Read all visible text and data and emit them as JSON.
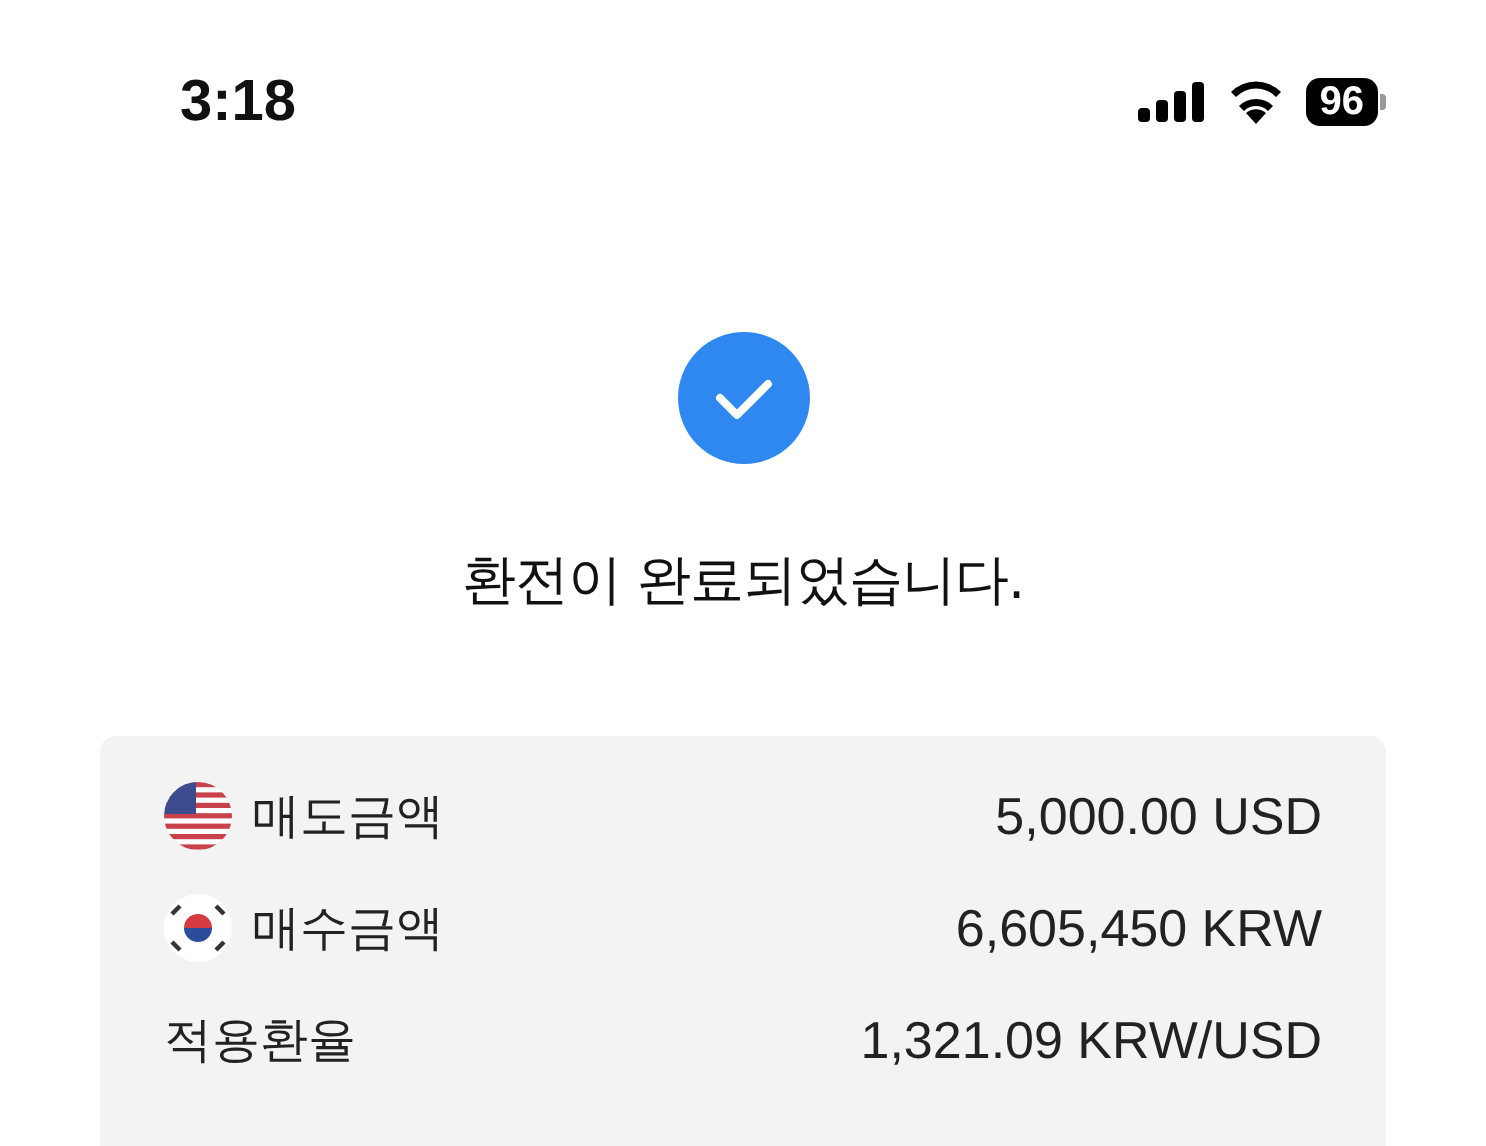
{
  "status_bar": {
    "time": "3:18",
    "battery": "96"
  },
  "result": {
    "title": "환전이 완료되었습니다."
  },
  "details": [
    {
      "kind": "us",
      "label": "매도금액",
      "value": "5,000.00 USD"
    },
    {
      "kind": "kr",
      "label": "매수금액",
      "value": "6,605,450 KRW"
    },
    {
      "kind": "plain",
      "label": "적용환율",
      "value": "1,321.09 KRW/USD"
    }
  ]
}
